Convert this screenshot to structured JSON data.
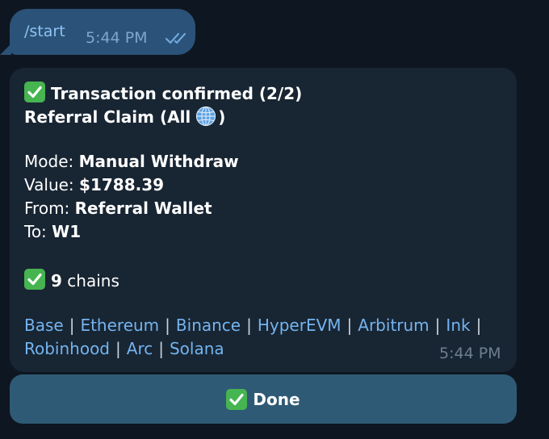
{
  "outgoing": {
    "text": "/start",
    "time": "5:44 PM",
    "status_icon": "double-check-icon"
  },
  "incoming": {
    "title": "Transaction confirmed (2/2)",
    "subtitle_prefix": "Referral Claim (All",
    "subtitle_suffix": ")",
    "mode_label": "Mode:",
    "mode_value": "Manual Withdraw",
    "value_label": "Value:",
    "value_value": "$1788.39",
    "from_label": "From:",
    "from_value": "Referral Wallet",
    "to_label": "To:",
    "to_value": "W1",
    "chains_count": "9",
    "chains_word": "chains",
    "links": [
      "Base",
      "Ethereum",
      "Binance",
      "HyperEVM",
      "Arbitrum",
      "Ink",
      "Robinhood",
      "Arc",
      "Solana"
    ],
    "separator": "|",
    "time": "5:44 PM"
  },
  "done_button": {
    "label": "Done"
  },
  "colors": {
    "background": "#0e1621",
    "outgoing_bubble": "#2b5278",
    "incoming_bubble": "#182533",
    "link": "#74b4ef",
    "button": "#2f5a75",
    "check_emoji": "#46b450"
  }
}
